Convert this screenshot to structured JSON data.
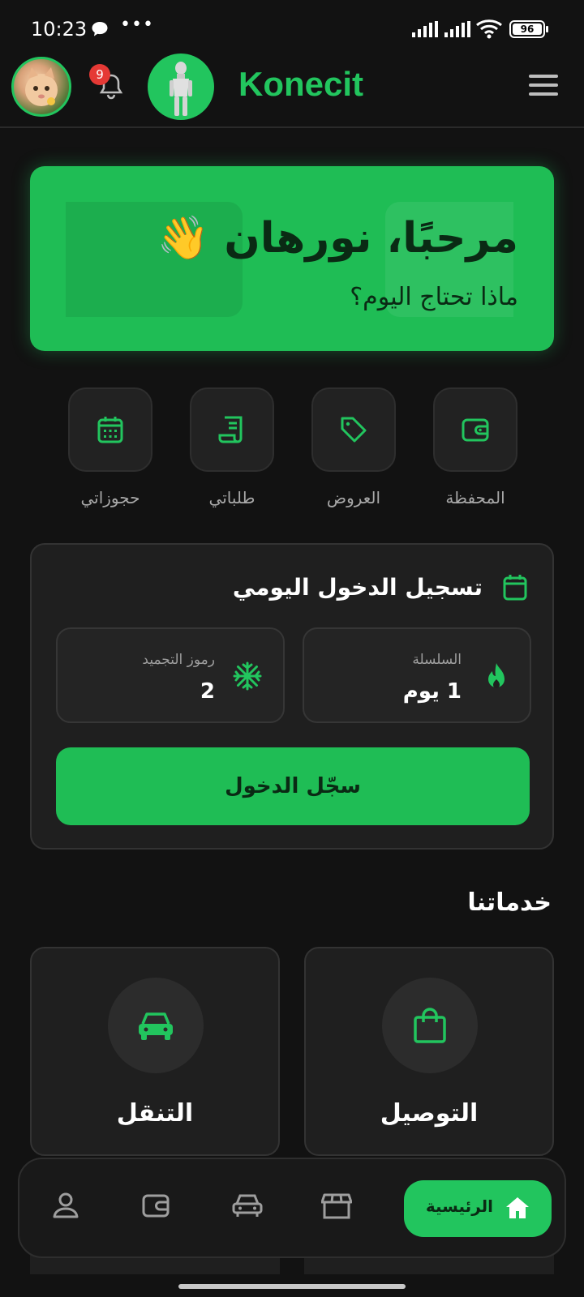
{
  "status_bar": {
    "time": "10:23",
    "dots": "•••",
    "battery": "96"
  },
  "header": {
    "notification_count": "9",
    "brand": "Konecit"
  },
  "welcome": {
    "title": "مرحبًا، نورهان 👋",
    "subtitle": "ماذا تحتاج اليوم؟"
  },
  "quick_actions": [
    {
      "label": "المحفظة",
      "icon": "wallet-icon"
    },
    {
      "label": "العروض",
      "icon": "tag-icon"
    },
    {
      "label": "طلباتي",
      "icon": "receipt-icon"
    },
    {
      "label": "حجوزاتي",
      "icon": "calendar-icon"
    }
  ],
  "checkin": {
    "title": "تسجيل الدخول اليومي",
    "streak_label": "السلسلة",
    "streak_value": "1 يوم",
    "freeze_label": "رموز التجميد",
    "freeze_value": "2",
    "button": "سجّل الدخول"
  },
  "services": {
    "title": "خدماتنا",
    "items": [
      {
        "label": "التوصيل",
        "icon": "shopping-bag-icon"
      },
      {
        "label": "التنقل",
        "icon": "car-icon"
      }
    ]
  },
  "bottom_nav": {
    "home_label": "الرئيسية",
    "items": [
      "home-icon",
      "store-icon",
      "car-icon",
      "wallet-icon",
      "user-icon"
    ]
  },
  "colors": {
    "accent": "#22c55e",
    "background": "#121212",
    "card": "#1f1f1f"
  }
}
